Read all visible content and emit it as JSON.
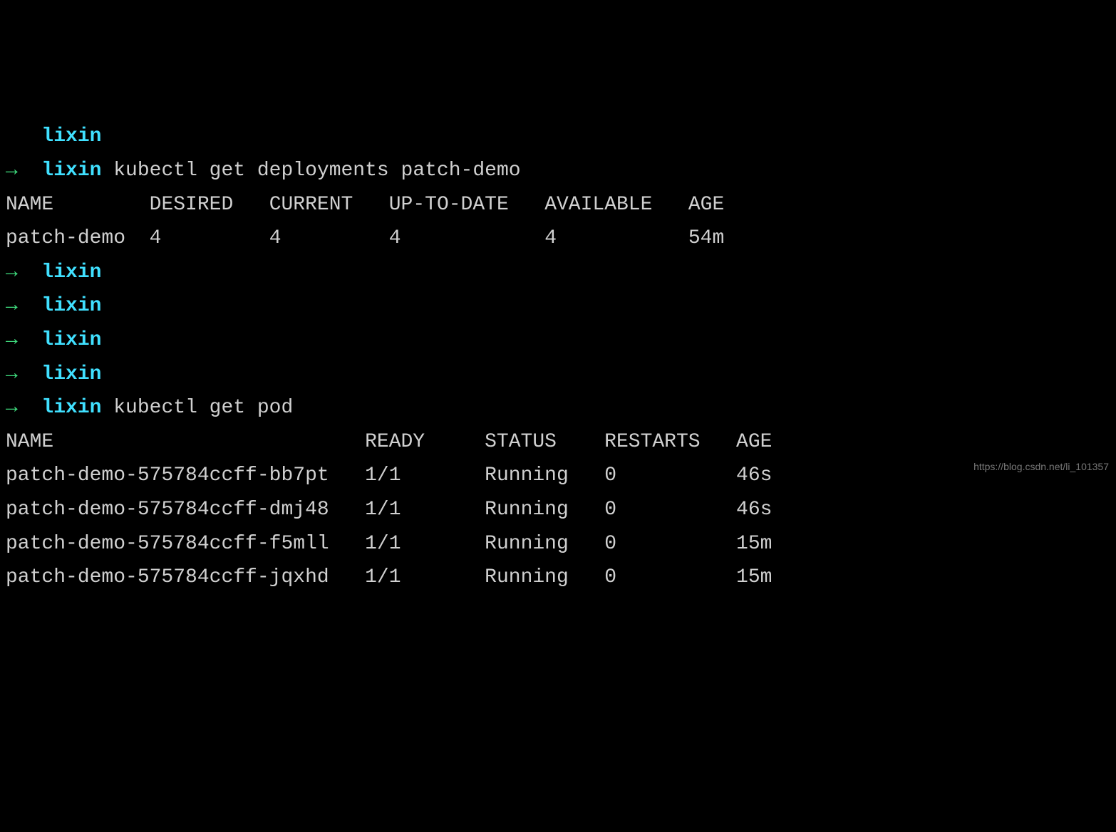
{
  "prompts": {
    "arrow": "→",
    "user": "lixin",
    "cmd1": "kubectl get deployments patch-demo",
    "cmd2": "kubectl get pod"
  },
  "deployments": {
    "headers": {
      "name": "NAME",
      "desired": "DESIRED",
      "current": "CURRENT",
      "uptodate": "UP-TO-DATE",
      "available": "AVAILABLE",
      "age": "AGE"
    },
    "rows": [
      {
        "name": "patch-demo",
        "desired": "4",
        "current": "4",
        "uptodate": "4",
        "available": "4",
        "age": "54m"
      }
    ]
  },
  "pods": {
    "headers": {
      "name": "NAME",
      "ready": "READY",
      "status": "STATUS",
      "restarts": "RESTARTS",
      "age": "AGE"
    },
    "rows": [
      {
        "name": "patch-demo-575784ccff-bb7pt",
        "ready": "1/1",
        "status": "Running",
        "restarts": "0",
        "age": "46s"
      },
      {
        "name": "patch-demo-575784ccff-dmj48",
        "ready": "1/1",
        "status": "Running",
        "restarts": "0",
        "age": "46s"
      },
      {
        "name": "patch-demo-575784ccff-f5mll",
        "ready": "1/1",
        "status": "Running",
        "restarts": "0",
        "age": "15m"
      },
      {
        "name": "patch-demo-575784ccff-jqxhd",
        "ready": "1/1",
        "status": "Running",
        "restarts": "0",
        "age": "15m"
      }
    ]
  },
  "watermark": "https://blog.csdn.net/li_101357"
}
